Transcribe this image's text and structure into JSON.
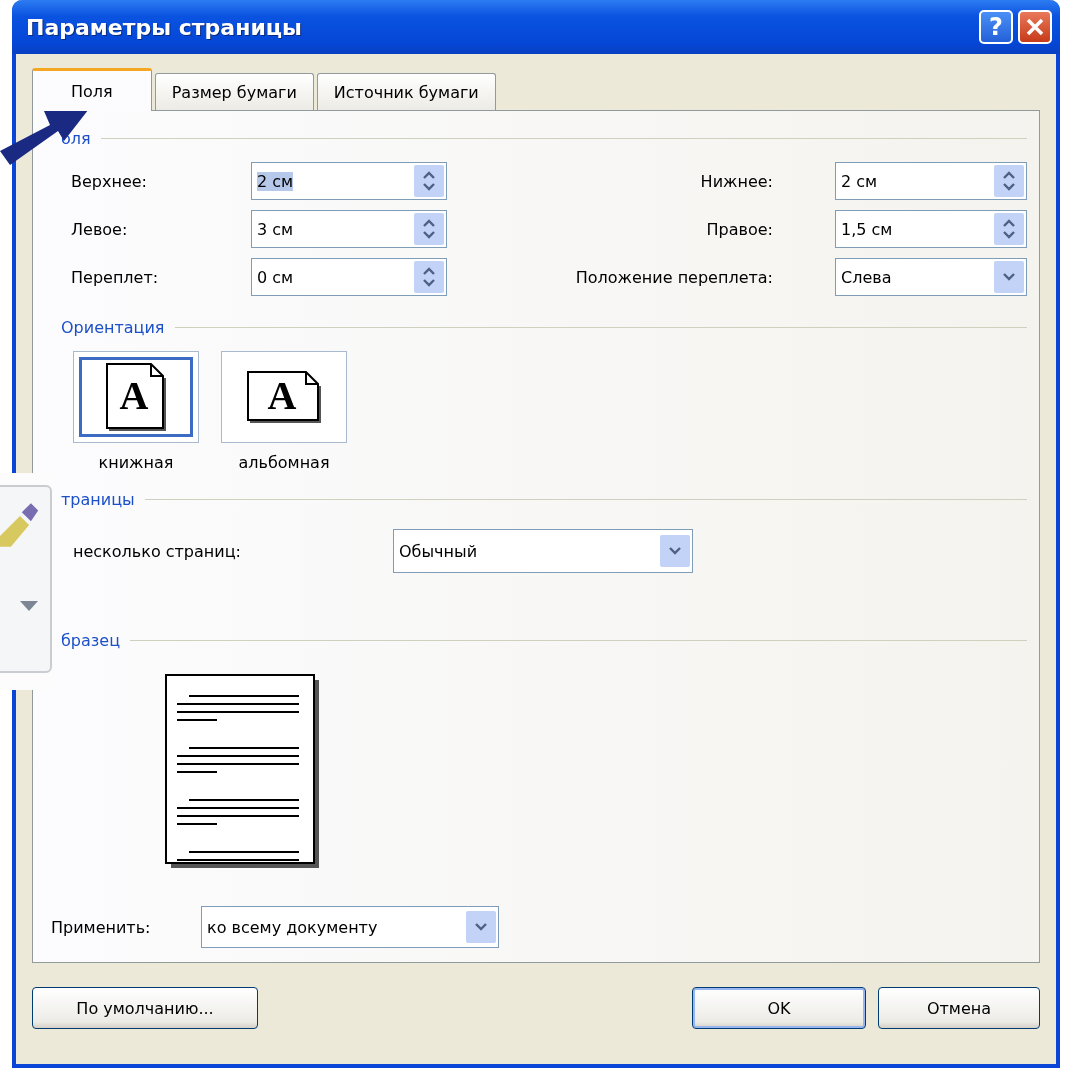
{
  "window": {
    "title": "Параметры страницы",
    "help_label": "?"
  },
  "tabs": [
    {
      "label": "Поля",
      "selected": true
    },
    {
      "label": "Размер бумаги",
      "selected": false
    },
    {
      "label": "Источник бумаги",
      "selected": false
    }
  ],
  "margins": {
    "title": "оля",
    "rows": [
      {
        "left": {
          "label": "Верхнее:",
          "value": "2 см",
          "kind": "spin",
          "highlighted": true
        },
        "right": {
          "label": "Нижнее:",
          "value": "2 см",
          "kind": "spin",
          "highlighted": false
        }
      },
      {
        "left": {
          "label": "Левое:",
          "value": "3 см",
          "kind": "spin",
          "highlighted": false
        },
        "right": {
          "label": "Правое:",
          "value": "1,5 см",
          "kind": "spin",
          "highlighted": false
        }
      },
      {
        "left": {
          "label": "Переплет:",
          "value": "0 см",
          "kind": "spin",
          "highlighted": false
        },
        "right": {
          "label": "Положение переплета:",
          "value": "Слева",
          "kind": "dropdown",
          "highlighted": false
        }
      }
    ]
  },
  "orientation": {
    "title": "Ориентация",
    "options": [
      {
        "label": "книжная",
        "glyph": "A",
        "kind": "portrait",
        "selected": true
      },
      {
        "label": "альбомная",
        "glyph": "A",
        "kind": "landscape",
        "selected": false
      }
    ]
  },
  "pages": {
    "title": "траницы",
    "label": "несколько страниц:",
    "value": "Обычный"
  },
  "preview": {
    "title": "бразец"
  },
  "apply": {
    "label": "Применить:",
    "value": "ко всему документу"
  },
  "buttons": [
    {
      "label": "По умолчанию...",
      "default": false
    },
    {
      "label": "OK",
      "default": true
    },
    {
      "label": "Отмена",
      "default": false
    }
  ]
}
